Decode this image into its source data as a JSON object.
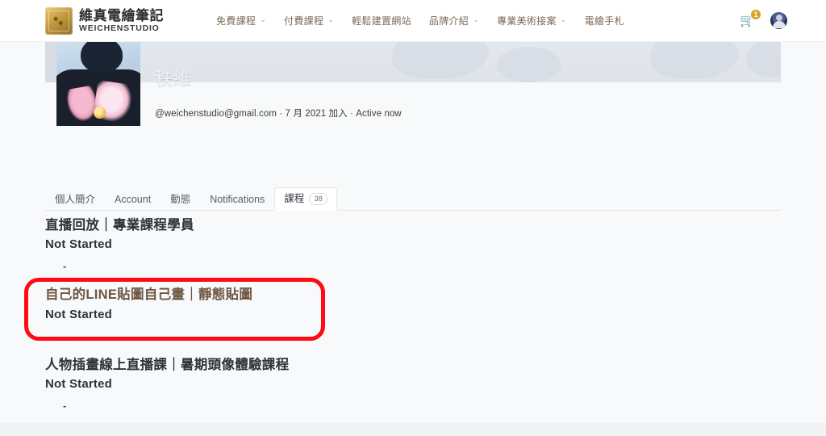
{
  "header": {
    "brand": {
      "logo_icon": "weichen-studio-logo-icon",
      "name_cn": "維真電繪筆記",
      "name_en": "WEICHENSTUDIO"
    },
    "nav": [
      {
        "label": "免費課程",
        "has_dropdown": true
      },
      {
        "label": "付費課程",
        "has_dropdown": true
      },
      {
        "label": "輕鬆建置網站",
        "has_dropdown": false
      },
      {
        "label": "品牌介紹",
        "has_dropdown": true
      },
      {
        "label": "專業美術接案",
        "has_dropdown": true
      },
      {
        "label": "電繪手札",
        "has_dropdown": false
      }
    ],
    "caret_glyph": "⌄",
    "cart": {
      "icon": "shopping-cart-icon",
      "glyph": "🛒",
      "badge": "1"
    },
    "account_avatar_icon": "user-avatar-icon"
  },
  "profile": {
    "avatar_icon": "profile-photo",
    "display_name": "秩維",
    "meta": "@weichenstudio@gmail.com · 7 月 2021 加入 · Active now"
  },
  "tabs": [
    {
      "label": "個人簡介",
      "active": false,
      "badge": null
    },
    {
      "label": "Account",
      "active": false,
      "badge": null
    },
    {
      "label": "動態",
      "active": false,
      "badge": null
    },
    {
      "label": "Notifications",
      "active": false,
      "badge": null
    },
    {
      "label": "課程",
      "active": true,
      "badge": "38"
    }
  ],
  "courses": [
    {
      "title": "直播回放｜專業課程學員",
      "status": "Not Started",
      "sub": "-",
      "highlighted": false
    },
    {
      "title": "自己的LINE貼圖自己畫｜靜態貼圖",
      "status": "Not Started",
      "sub": "-",
      "highlighted": true
    },
    {
      "title": "人物插畫線上直播課｜暑期頭像體驗課程",
      "status": "Not Started",
      "sub": "-",
      "highlighted": false
    }
  ],
  "annotation": {
    "shape": "rounded-rectangle",
    "color": "#ff0a12",
    "targets_course_index": 1
  },
  "colors": {
    "page_background": "#f8f9fa",
    "nav_text": "#7a6a58",
    "accent_course_title": "#6d5743",
    "badge_gold": "#d8a126",
    "annotation_red": "#ff0a12"
  }
}
